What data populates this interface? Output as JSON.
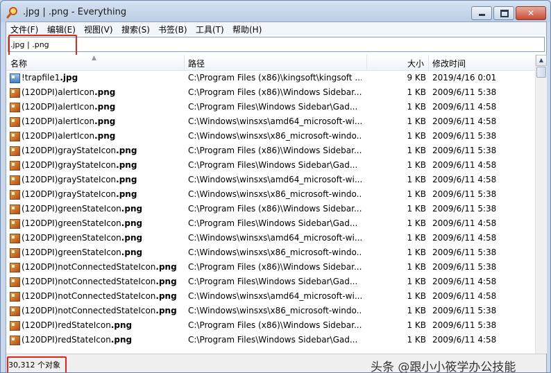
{
  "window": {
    "title": ".jpg | .png - Everything"
  },
  "menu": [
    "文件(F)",
    "编辑(E)",
    "视图(V)",
    "搜索(S)",
    "书签(B)",
    "工具(T)",
    "帮助(H)"
  ],
  "search": {
    "value": ".jpg | .png"
  },
  "columns": {
    "name": "名称",
    "path": "路径",
    "size": "大小",
    "date": "修改时间"
  },
  "rows": [
    {
      "name": "!trapfile1",
      "ext": ".jpg",
      "path": "C:\\Program Files (x86)\\kingsoft\\kingsoft ...",
      "size": "9 KB",
      "date": "2019/4/16 0:01",
      "icon": "jpg"
    },
    {
      "name": "(120DPI)alertIcon",
      "ext": ".png",
      "path": "C:\\Program Files (x86)\\Windows Sidebar...",
      "size": "1 KB",
      "date": "2009/6/11 5:38",
      "icon": "png"
    },
    {
      "name": "(120DPI)alertIcon",
      "ext": ".png",
      "path": "C:\\Program Files\\Windows Sidebar\\Gad...",
      "size": "1 KB",
      "date": "2009/6/11 4:58",
      "icon": "png"
    },
    {
      "name": "(120DPI)alertIcon",
      "ext": ".png",
      "path": "C:\\Windows\\winsxs\\amd64_microsoft-wi...",
      "size": "1 KB",
      "date": "2009/6/11 4:58",
      "icon": "png"
    },
    {
      "name": "(120DPI)alertIcon",
      "ext": ".png",
      "path": "C:\\Windows\\winsxs\\x86_microsoft-windo...",
      "size": "1 KB",
      "date": "2009/6/11 5:38",
      "icon": "png"
    },
    {
      "name": "(120DPI)grayStateIcon",
      "ext": ".png",
      "path": "C:\\Program Files (x86)\\Windows Sidebar...",
      "size": "1 KB",
      "date": "2009/6/11 5:38",
      "icon": "png"
    },
    {
      "name": "(120DPI)grayStateIcon",
      "ext": ".png",
      "path": "C:\\Program Files\\Windows Sidebar\\Gad...",
      "size": "1 KB",
      "date": "2009/6/11 4:58",
      "icon": "png"
    },
    {
      "name": "(120DPI)grayStateIcon",
      "ext": ".png",
      "path": "C:\\Windows\\winsxs\\amd64_microsoft-wi...",
      "size": "1 KB",
      "date": "2009/6/11 4:58",
      "icon": "png"
    },
    {
      "name": "(120DPI)grayStateIcon",
      "ext": ".png",
      "path": "C:\\Windows\\winsxs\\x86_microsoft-windo...",
      "size": "1 KB",
      "date": "2009/6/11 5:38",
      "icon": "png"
    },
    {
      "name": "(120DPI)greenStateIcon",
      "ext": ".png",
      "path": "C:\\Program Files (x86)\\Windows Sidebar...",
      "size": "1 KB",
      "date": "2009/6/11 5:38",
      "icon": "png"
    },
    {
      "name": "(120DPI)greenStateIcon",
      "ext": ".png",
      "path": "C:\\Program Files\\Windows Sidebar\\Gad...",
      "size": "1 KB",
      "date": "2009/6/11 4:58",
      "icon": "png"
    },
    {
      "name": "(120DPI)greenStateIcon",
      "ext": ".png",
      "path": "C:\\Windows\\winsxs\\amd64_microsoft-wi...",
      "size": "1 KB",
      "date": "2009/6/11 4:58",
      "icon": "png"
    },
    {
      "name": "(120DPI)greenStateIcon",
      "ext": ".png",
      "path": "C:\\Windows\\winsxs\\x86_microsoft-windo...",
      "size": "1 KB",
      "date": "2009/6/11 5:38",
      "icon": "png"
    },
    {
      "name": "(120DPI)notConnectedStateIcon",
      "ext": ".png",
      "path": "C:\\Program Files (x86)\\Windows Sidebar...",
      "size": "1 KB",
      "date": "2009/6/11 5:38",
      "icon": "png"
    },
    {
      "name": "(120DPI)notConnectedStateIcon",
      "ext": ".png",
      "path": "C:\\Program Files\\Windows Sidebar\\Gad...",
      "size": "1 KB",
      "date": "2009/6/11 4:58",
      "icon": "png"
    },
    {
      "name": "(120DPI)notConnectedStateIcon",
      "ext": ".png",
      "path": "C:\\Windows\\winsxs\\amd64_microsoft-wi...",
      "size": "1 KB",
      "date": "2009/6/11 4:58",
      "icon": "png"
    },
    {
      "name": "(120DPI)notConnectedStateIcon",
      "ext": ".png",
      "path": "C:\\Windows\\winsxs\\x86_microsoft-windo...",
      "size": "1 KB",
      "date": "2009/6/11 5:38",
      "icon": "png"
    },
    {
      "name": "(120DPI)redStateIcon",
      "ext": ".png",
      "path": "C:\\Program Files (x86)\\Windows Sidebar...",
      "size": "1 KB",
      "date": "2009/6/11 5:38",
      "icon": "png"
    },
    {
      "name": "(120DPI)redStateIcon",
      "ext": ".png",
      "path": "C:\\Program Files\\Windows Sidebar\\Gad...",
      "size": "1 KB",
      "date": "2009/6/11 4:58",
      "icon": "png"
    }
  ],
  "status": {
    "count": "30,312 个对象"
  },
  "watermark": "头条 @跟小小筱学办公技能",
  "colors": {
    "highlight_border": "#e0261a",
    "window_frame": "#6d85a8"
  }
}
